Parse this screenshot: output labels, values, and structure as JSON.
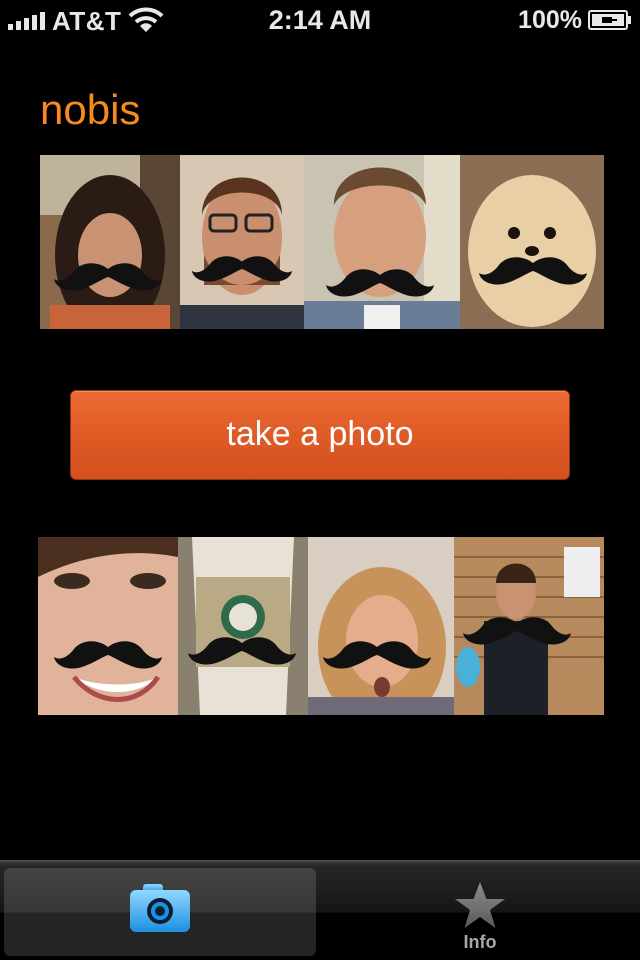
{
  "status_bar": {
    "carrier": "AT&T",
    "time": "2:14 AM",
    "battery_percent": "100%"
  },
  "app": {
    "title": "nobis",
    "title_color": "#f58a1f"
  },
  "gallery": {
    "top_row": [
      "woman-with-mustache-photo",
      "man-with-glasses-mustache-photo",
      "man-with-mustache-photo",
      "dog-with-mustache-photo"
    ],
    "bottom_row": [
      "smiling-woman-mustache-photo",
      "coffee-cup-mustache-photo",
      "blonde-woman-mustache-photo",
      "man-with-toy-mustache-photo"
    ]
  },
  "action": {
    "take_photo_label": "take a photo",
    "button_color": "#de5a25"
  },
  "tab_bar": {
    "tabs": [
      {
        "icon": "camera-icon",
        "label": "",
        "selected": true
      },
      {
        "icon": "star-icon",
        "label": "Info",
        "selected": false
      }
    ]
  }
}
